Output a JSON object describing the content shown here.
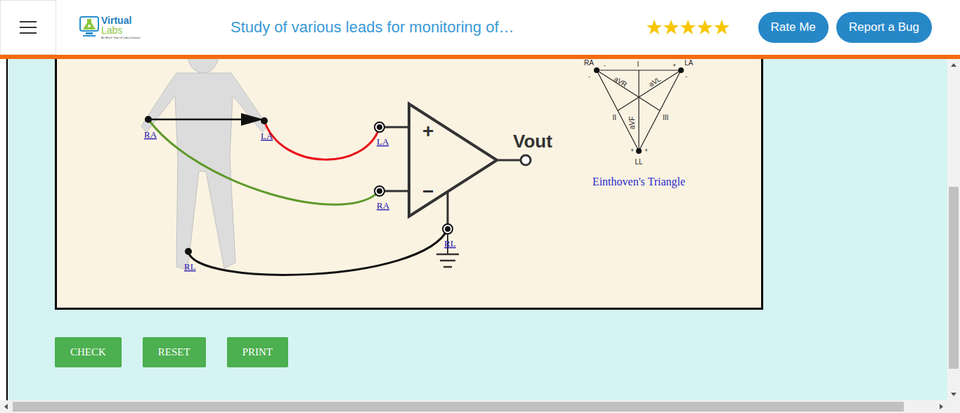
{
  "header": {
    "logo": {
      "line1": "Virtual",
      "line2": "Labs",
      "tagline": "An MeitY Govt of India Initiative"
    },
    "title": "Study of various leads for monitoring of…",
    "rating": {
      "stars": 5
    },
    "buttons": [
      "Rate Me",
      "Report a Bug"
    ]
  },
  "diagram": {
    "electrodes": [
      "RA",
      "LA",
      "RL"
    ],
    "amplifier": {
      "plus": "+",
      "minus": "−",
      "inputs": [
        "LA",
        "RA",
        "RL"
      ],
      "output": "Vout"
    },
    "wires": [
      {
        "from": "LA",
        "to": "LA",
        "color": "#e8141c"
      },
      {
        "from": "RA",
        "to": "RA",
        "color": "#5e9a2c"
      },
      {
        "from": "RL",
        "to": "RL",
        "color": "#111111"
      }
    ]
  },
  "triangle": {
    "vertices": [
      "RA",
      "LA",
      "LL"
    ],
    "leads": [
      "I",
      "II",
      "III",
      "aVR",
      "aVL",
      "aVF"
    ],
    "signs": [
      "-",
      "+",
      "-",
      "-",
      "+",
      "+"
    ],
    "caption": "Einthoven's Triangle"
  },
  "actions": [
    "CHECK",
    "RESET",
    "PRINT"
  ]
}
